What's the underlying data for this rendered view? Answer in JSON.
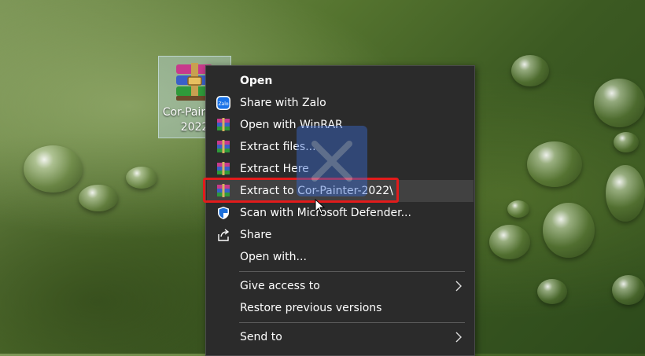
{
  "desktop": {
    "file_name_line1": "Cor-Painter-",
    "file_name_line2": "2022"
  },
  "context_menu": {
    "items": [
      {
        "label": "Open",
        "icon": "none"
      },
      {
        "label": "Share with Zalo",
        "icon": "zalo-icon"
      },
      {
        "label": "Open with WinRAR",
        "icon": "winrar-icon"
      },
      {
        "label": "Extract files...",
        "icon": "winrar-icon"
      },
      {
        "label": "Extract Here",
        "icon": "winrar-icon"
      },
      {
        "label": "Extract to Cor-Painter-2022\\",
        "icon": "winrar-icon"
      },
      {
        "label": "Scan with Microsoft Defender...",
        "icon": "defender-shield-icon"
      },
      {
        "label": "Share",
        "icon": "share-icon"
      },
      {
        "label": "Open with...",
        "icon": "none"
      },
      {
        "label": "Give access to",
        "icon": "none",
        "submenu": true
      },
      {
        "label": "Restore previous versions",
        "icon": "none"
      },
      {
        "label": "Send to",
        "icon": "none",
        "submenu": true
      }
    ]
  },
  "colors": {
    "menu_bg": "#2b2b2b",
    "highlight": "#e21b1b",
    "hover": "#414141"
  }
}
